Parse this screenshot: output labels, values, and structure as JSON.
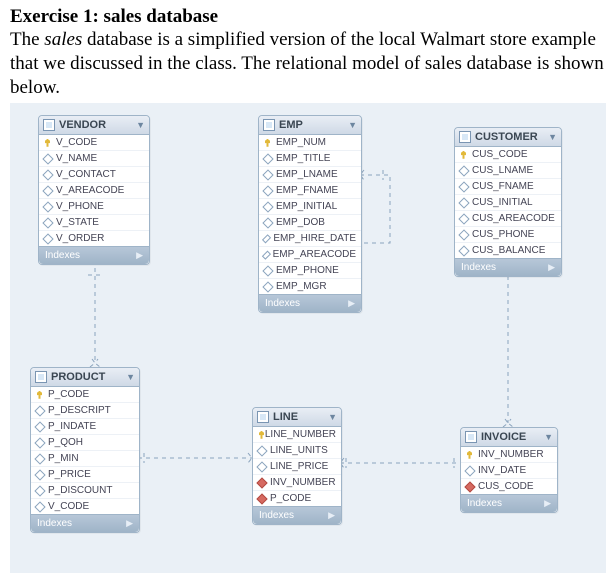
{
  "heading": "Exercise 1: sales database",
  "intro_parts": {
    "a": "The ",
    "b_italic": "sales",
    "c": " database is a simplified version of the local Walmart store example that we discussed in the class. The relational model of sales database is shown below."
  },
  "labels": {
    "indexes": "Indexes"
  },
  "tables": {
    "vendor": {
      "title": "VENDOR",
      "cols": [
        {
          "n": "V_CODE",
          "t": "key"
        },
        {
          "n": "V_NAME",
          "t": "dia"
        },
        {
          "n": "V_CONTACT",
          "t": "dia"
        },
        {
          "n": "V_AREACODE",
          "t": "dia"
        },
        {
          "n": "V_PHONE",
          "t": "dia"
        },
        {
          "n": "V_STATE",
          "t": "dia"
        },
        {
          "n": "V_ORDER",
          "t": "dia"
        }
      ]
    },
    "emp": {
      "title": "EMP",
      "cols": [
        {
          "n": "EMP_NUM",
          "t": "key"
        },
        {
          "n": "EMP_TITLE",
          "t": "dia"
        },
        {
          "n": "EMP_LNAME",
          "t": "dia"
        },
        {
          "n": "EMP_FNAME",
          "t": "dia"
        },
        {
          "n": "EMP_INITIAL",
          "t": "dia"
        },
        {
          "n": "EMP_DOB",
          "t": "dia"
        },
        {
          "n": "EMP_HIRE_DATE",
          "t": "dia"
        },
        {
          "n": "EMP_AREACODE",
          "t": "dia"
        },
        {
          "n": "EMP_PHONE",
          "t": "dia"
        },
        {
          "n": "EMP_MGR",
          "t": "dia"
        }
      ]
    },
    "customer": {
      "title": "CUSTOMER",
      "cols": [
        {
          "n": "CUS_CODE",
          "t": "key"
        },
        {
          "n": "CUS_LNAME",
          "t": "dia"
        },
        {
          "n": "CUS_FNAME",
          "t": "dia"
        },
        {
          "n": "CUS_INITIAL",
          "t": "dia"
        },
        {
          "n": "CUS_AREACODE",
          "t": "dia"
        },
        {
          "n": "CUS_PHONE",
          "t": "dia"
        },
        {
          "n": "CUS_BALANCE",
          "t": "dia"
        }
      ]
    },
    "product": {
      "title": "PRODUCT",
      "cols": [
        {
          "n": "P_CODE",
          "t": "key"
        },
        {
          "n": "P_DESCRIPT",
          "t": "dia"
        },
        {
          "n": "P_INDATE",
          "t": "dia"
        },
        {
          "n": "P_QOH",
          "t": "dia"
        },
        {
          "n": "P_MIN",
          "t": "dia"
        },
        {
          "n": "P_PRICE",
          "t": "dia"
        },
        {
          "n": "P_DISCOUNT",
          "t": "dia"
        },
        {
          "n": "V_CODE",
          "t": "dia"
        }
      ]
    },
    "line": {
      "title": "LINE",
      "cols": [
        {
          "n": "LINE_NUMBER",
          "t": "key"
        },
        {
          "n": "LINE_UNITS",
          "t": "dia"
        },
        {
          "n": "LINE_PRICE",
          "t": "dia"
        },
        {
          "n": "INV_NUMBER",
          "t": "dia red"
        },
        {
          "n": "P_CODE",
          "t": "dia red"
        }
      ]
    },
    "invoice": {
      "title": "INVOICE",
      "cols": [
        {
          "n": "INV_NUMBER",
          "t": "key"
        },
        {
          "n": "INV_DATE",
          "t": "dia"
        },
        {
          "n": "CUS_CODE",
          "t": "dia red"
        }
      ]
    }
  }
}
